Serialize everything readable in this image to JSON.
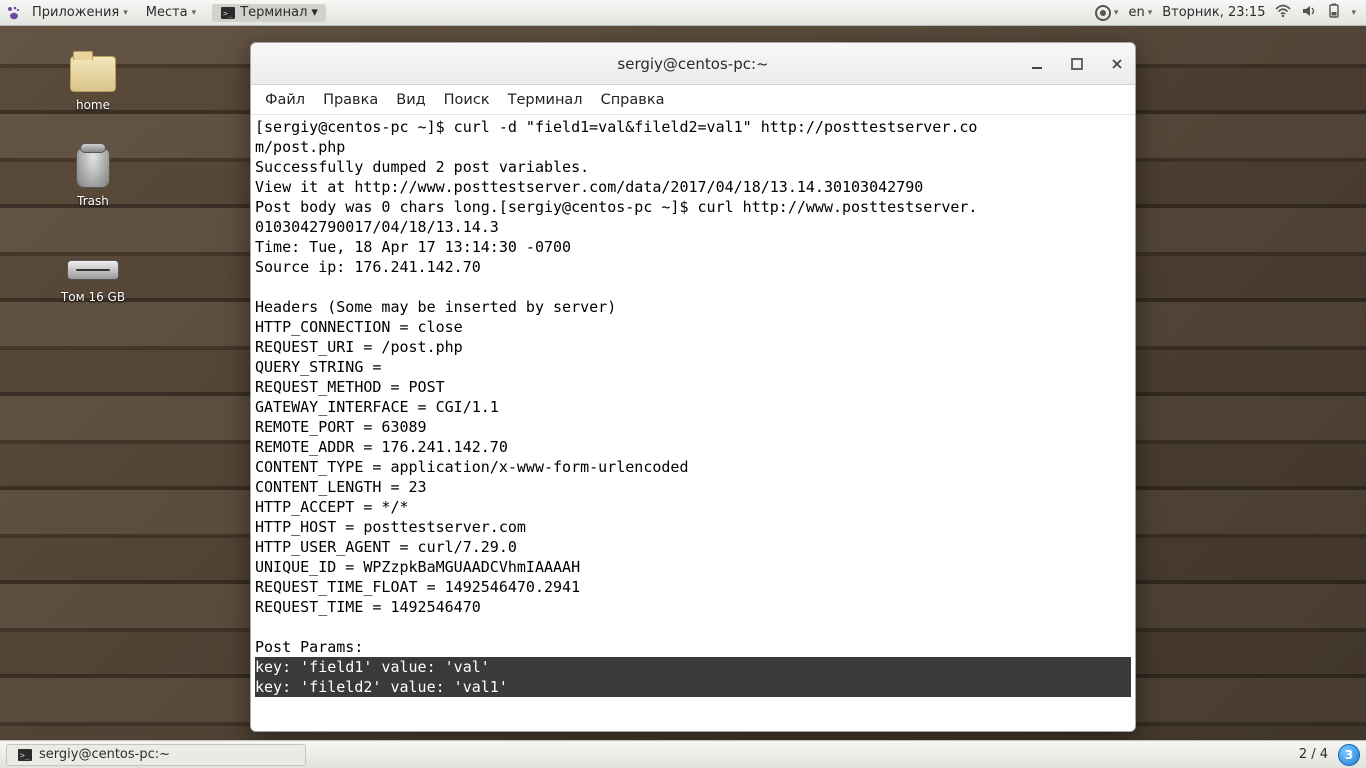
{
  "top_panel": {
    "apps": "Приложения",
    "places": "Места",
    "active_app": "Терминал",
    "lang": "en",
    "clock": "Вторник, 23:15"
  },
  "desktop": {
    "home": "home",
    "trash": "Trash",
    "volume": "Том 16 GB"
  },
  "window": {
    "title": "sergiy@centos-pc:~",
    "menus": {
      "file": "Файл",
      "edit": "Правка",
      "view": "Вид",
      "search": "Поиск",
      "terminal": "Терминал",
      "help": "Справка"
    }
  },
  "terminal": {
    "lines": [
      "[sergiy@centos-pc ~]$ curl -d \"field1=val&fileld2=val1\" http://posttestserver.co",
      "m/post.php",
      "Successfully dumped 2 post variables.",
      "View it at http://www.posttestserver.com/data/2017/04/18/13.14.30103042790",
      "Post body was 0 chars long.[sergiy@centos-pc ~]$ curl http://www.posttestserver.",
      "0103042790017/04/18/13.14.3",
      "Time: Tue, 18 Apr 17 13:14:30 -0700",
      "Source ip: 176.241.142.70",
      "",
      "Headers (Some may be inserted by server)",
      "HTTP_CONNECTION = close",
      "REQUEST_URI = /post.php",
      "QUERY_STRING = ",
      "REQUEST_METHOD = POST",
      "GATEWAY_INTERFACE = CGI/1.1",
      "REMOTE_PORT = 63089",
      "REMOTE_ADDR = 176.241.142.70",
      "CONTENT_TYPE = application/x-www-form-urlencoded",
      "CONTENT_LENGTH = 23",
      "HTTP_ACCEPT = */*",
      "HTTP_HOST = posttestserver.com",
      "HTTP_USER_AGENT = curl/7.29.0",
      "UNIQUE_ID = WPZzpkBaMGUAADCVhmIAAAAH",
      "REQUEST_TIME_FLOAT = 1492546470.2941",
      "REQUEST_TIME = 1492546470",
      "",
      "Post Params:"
    ],
    "selected": [
      "key: 'field1' value: 'val'",
      "key: 'fileld2' value: 'val1'"
    ]
  },
  "taskbar": {
    "task": "sergiy@centos-pc:~",
    "workspace": "2 / 4",
    "ws_active": "3"
  }
}
